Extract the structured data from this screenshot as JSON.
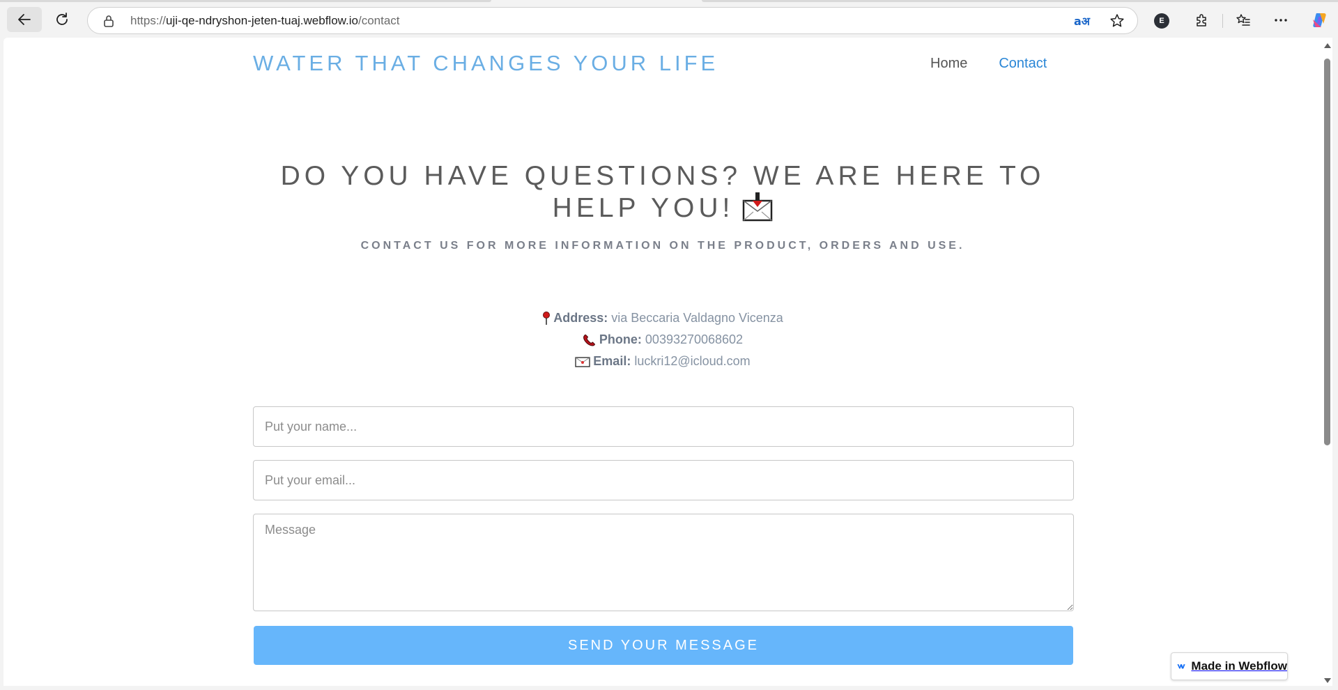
{
  "browser": {
    "url_scheme": "https://",
    "url_host": "uji-qe-ndryshon-jeten-tuaj.webflow.io",
    "url_path": "/contact",
    "translate_glyph": "aअ",
    "profile_initial": "E"
  },
  "site": {
    "brand": "WATER THAT CHANGES YOUR LIFE",
    "nav": [
      {
        "label": "Home"
      },
      {
        "label": "Contact"
      }
    ]
  },
  "hero": {
    "title": "DO YOU HAVE QUESTIONS? WE ARE HERE TO HELP YOU!",
    "subtitle": "CONTACT US FOR MORE INFORMATION ON THE PRODUCT, ORDERS AND USE."
  },
  "contact": {
    "address_label": "Address:",
    "address_value": "via Beccaria Valdagno Vicenza",
    "phone_label": "Phone:",
    "phone_value": "00393270068602",
    "email_label": "Email:",
    "email_value": "luckri12@icloud.com"
  },
  "form": {
    "name_placeholder": "Put your name...",
    "email_placeholder": "Put your email...",
    "message_placeholder": "Message",
    "submit_label": "SEND YOUR MESSAGE"
  },
  "badge": {
    "label": "Made in Webflow"
  },
  "colors": {
    "brand": "#6aaee4",
    "nav_active": "#2a86d6",
    "button": "#66b6fb"
  }
}
